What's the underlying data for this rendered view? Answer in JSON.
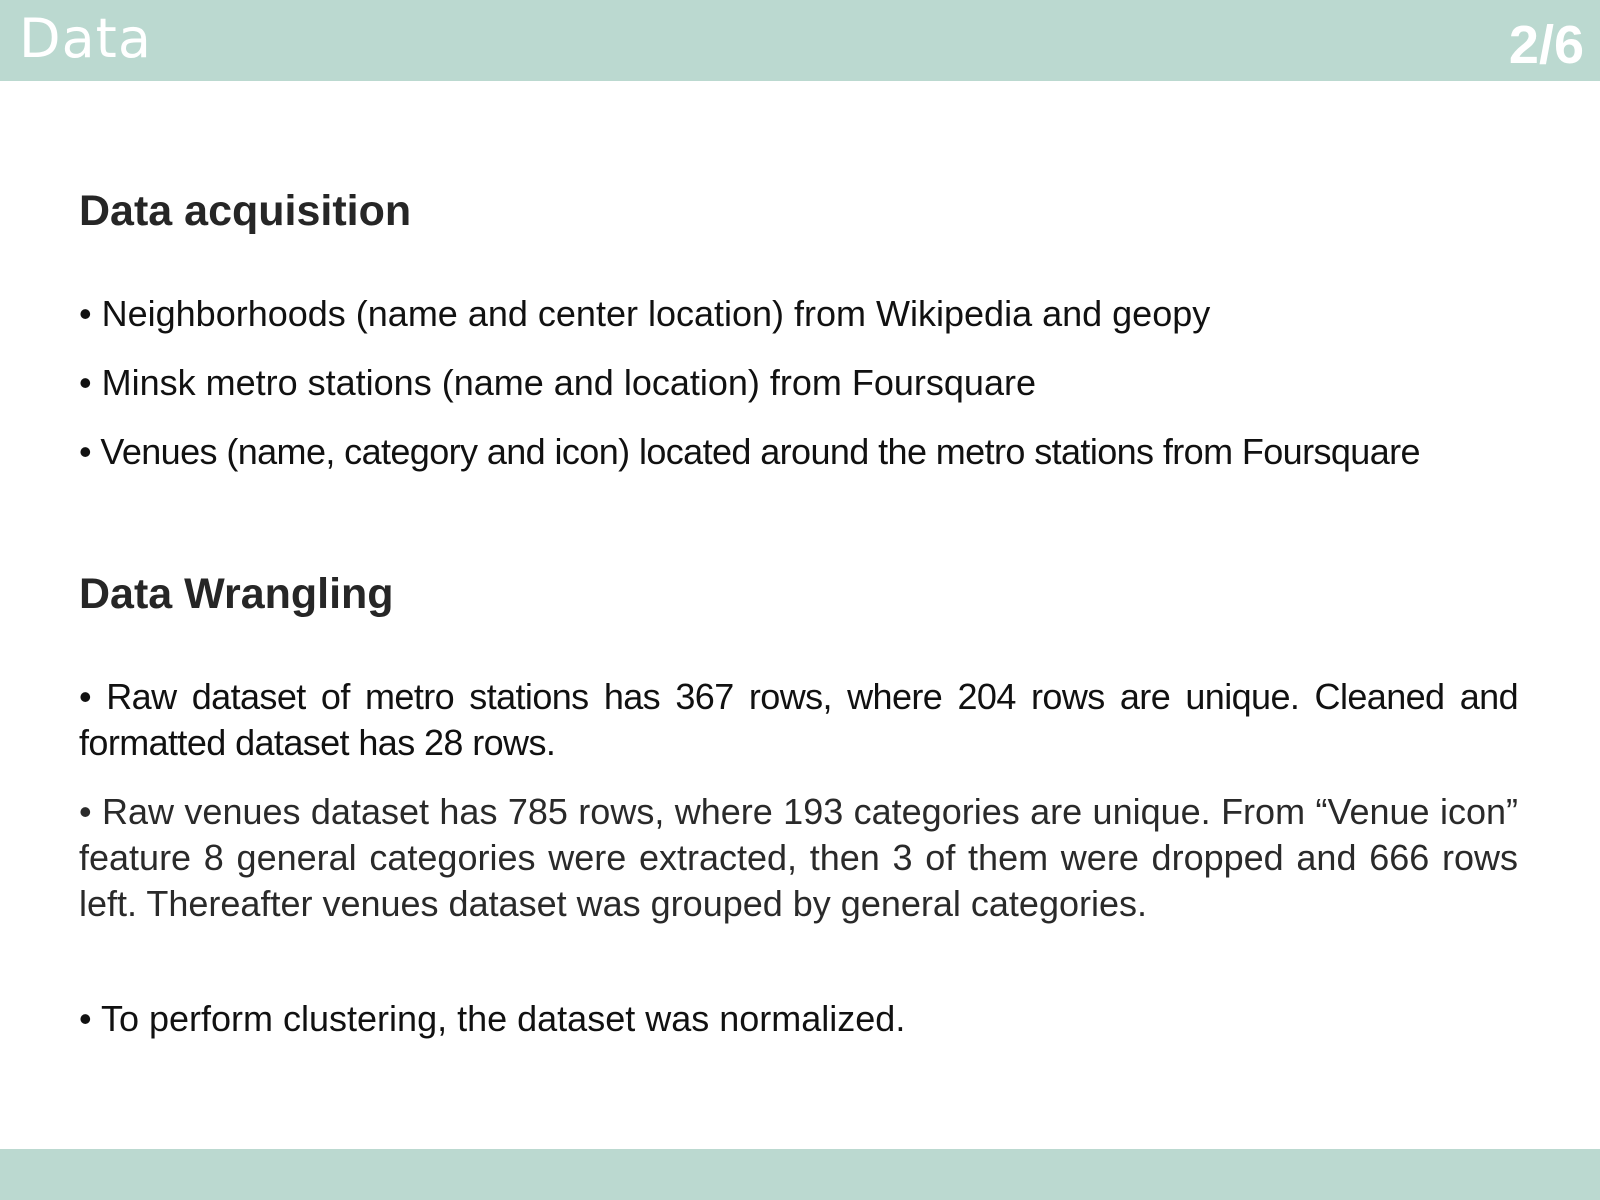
{
  "header": {
    "title": "Data",
    "page_number": "2/6"
  },
  "sections": [
    {
      "heading": "Data acquisition",
      "bullets": [
        "• Neighborhoods (name and center location) from Wikipedia and geopy",
        "• Minsk metro stations (name and location) from Foursquare",
        "• Venues (name, category and icon) located around the metro stations from Foursquare"
      ]
    },
    {
      "heading": "Data Wrangling",
      "bullets": [
        "• Raw dataset of metro stations has 367 rows, where 204 rows are unique. Cleaned and formatted dataset has 28 rows.",
        "• Raw venues dataset has 785 rows, where 193 categories are unique. From “Venue icon” feature 8 general categories were extracted, then 3 of them were dropped and 666 rows left. Thereafter venues dataset was grouped by general categories.",
        "• To perform clustering, the dataset was normalized."
      ]
    }
  ]
}
